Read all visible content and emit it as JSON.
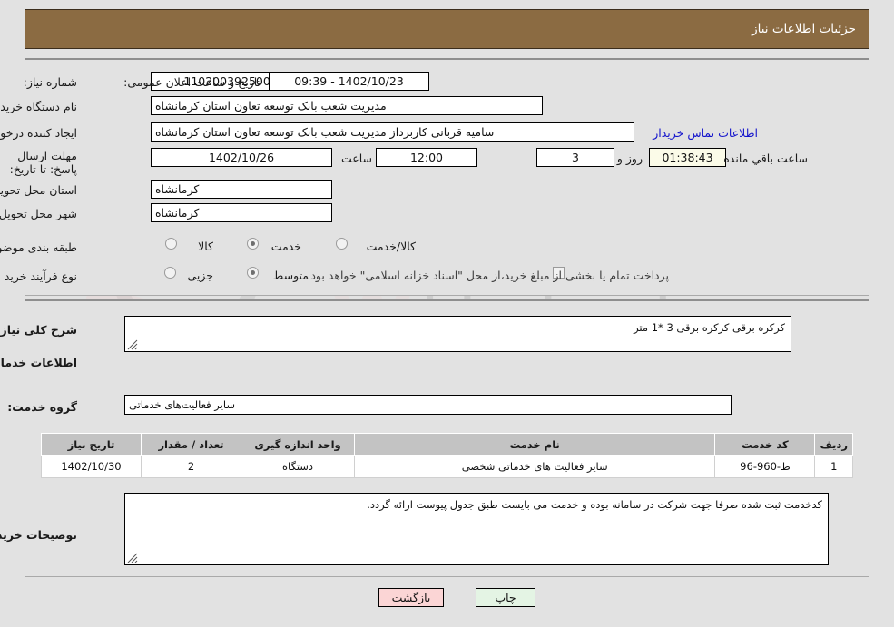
{
  "header": {
    "title": "جزئیات اطلاعات نیاز"
  },
  "fields": {
    "need_number": {
      "label": "شماره نیاز:",
      "value": "1102003925000059"
    },
    "buyer_org": {
      "label": "نام دستگاه خریدار:",
      "value": "مدیریت شعب بانک توسعه تعاون استان کرمانشاه"
    },
    "creator": {
      "label": "ایجاد کننده درخواست:",
      "value": "سامیه قربانی کاربرداز مدیریت شعب بانک توسعه تعاون استان کرمانشاه"
    },
    "contact_link": "اطلاعات تماس خریدار",
    "announce": {
      "label": "تاریخ و ساعت اعلان عمومی:",
      "value": "1402/10/23 - 09:39"
    },
    "deadline": {
      "label": "مهلت ارسال پاسخ: تا تاریخ:",
      "value": "1402/10/26"
    },
    "deadline_hour_label": "ساعت",
    "deadline_hour": "12:00",
    "days_left": "3",
    "days_left_label": "روز و",
    "time_left": "01:38:43",
    "time_left_label": "ساعت باقي مانده",
    "province": {
      "label": "استان محل تحویل:",
      "value": "کرمانشاه"
    },
    "city": {
      "label": "شهر محل تحویل:",
      "value": "کرمانشاه"
    },
    "category": {
      "label": "طبقه بندی موضوعی:"
    },
    "process": {
      "label": "نوع فرآیند خرید :"
    }
  },
  "category_options": [
    {
      "label": "کالا",
      "selected": false
    },
    {
      "label": "خدمت",
      "selected": true
    },
    {
      "label": "کالا/خدمت",
      "selected": false
    }
  ],
  "process_options": [
    {
      "label": "جزیی",
      "selected": false
    },
    {
      "label": "متوسط",
      "selected": true
    }
  ],
  "treasury": {
    "checked": false,
    "text": "پرداخت تمام یا بخشی از مبلغ خرید،از محل \"اسناد خزانه اسلامی\" خواهد بود."
  },
  "description": {
    "label": "شرح کلی نیاز:",
    "value": "کرکره برقی کرکره برقی 3 *1 متر"
  },
  "services_section_title": "اطلاعات خدمات مورد نیاز",
  "service_group": {
    "label": "گروه خدمت:",
    "value": "سایر فعالیت‌های خدماتی"
  },
  "table": {
    "headers": [
      "ردیف",
      "کد خدمت",
      "نام خدمت",
      "واحد اندازه گیری",
      "تعداد / مقدار",
      "تاریخ نیاز"
    ],
    "rows": [
      {
        "row_no": "1",
        "service_code": "ط-960-96",
        "service_name": "سایر فعالیت های خدماتی شخصی",
        "unit": "دستگاه",
        "quantity": "2",
        "need_date": "1402/10/30"
      }
    ]
  },
  "buyer_notes": {
    "label": "توضیحات خریدار:",
    "value": "کدخدمت ثبت شده صرفا جهت شرکت در سامانه بوده و خدمت می بایست طبق جدول پیوست ارائه گردد."
  },
  "buttons": {
    "print": "چاپ",
    "back": "بازگشت"
  },
  "watermark": {
    "brand": "AriaTender.net",
    "brand2": "ariatender.net"
  },
  "colors": {
    "header_bg": "#8b6b42",
    "page_bg": "#e2e2e2",
    "link": "#1414cc",
    "print_btn": "#e4f4e4",
    "back_btn": "#fbd5d5",
    "table_header": "#c3c3c3"
  }
}
